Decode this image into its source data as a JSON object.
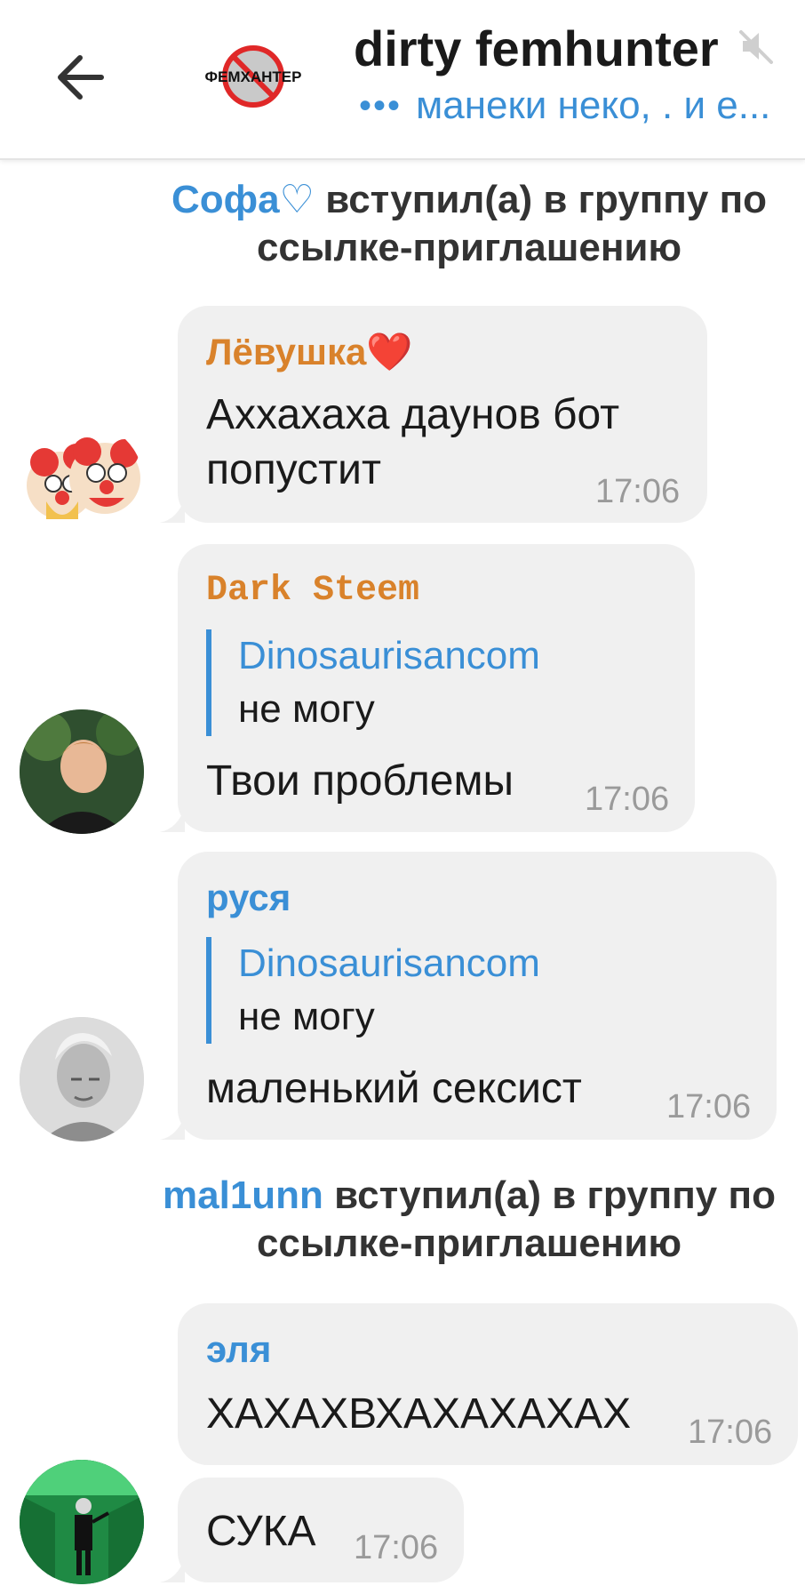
{
  "header": {
    "title": "dirty femhunter",
    "typing_indicator": "•••",
    "subtitle": "манеки неко, . и е...",
    "avatar_text": "ФЕМХАНТЕР"
  },
  "colors": {
    "accent": "#3a8fd6",
    "bubble": "#f0f0f0",
    "orange_name": "#d9822b",
    "blue_name": "#3a8fd6"
  },
  "events": [
    {
      "who": "Софа♡",
      "text": "вступил(а) в группу по ссылке-приглашению"
    },
    {
      "who": "mal1unn",
      "text": "вступил(а) в группу по ссылке-приглашению"
    }
  ],
  "messages": [
    {
      "sender": "Лёвушка❤️",
      "text_line1": "Аххахаха даунов бот",
      "text_line2": "попустит",
      "time": "17:06"
    },
    {
      "sender": "Dark Steem",
      "reply_name": "Dinosaurisancom",
      "reply_text": "не могу",
      "text": "Твои проблемы",
      "time": "17:06"
    },
    {
      "sender": "руся",
      "reply_name": "Dinosaurisancom",
      "reply_text": "не могу",
      "text": "маленький сексист",
      "time": "17:06"
    },
    {
      "sender": "эля",
      "text": "ХАХАХВХАХАХАХАХ",
      "time": "17:06"
    },
    {
      "text": "СУКА",
      "time": "17:06"
    }
  ],
  "icons": {
    "back": "arrow-left-icon",
    "mute": "muted-speaker-icon"
  }
}
